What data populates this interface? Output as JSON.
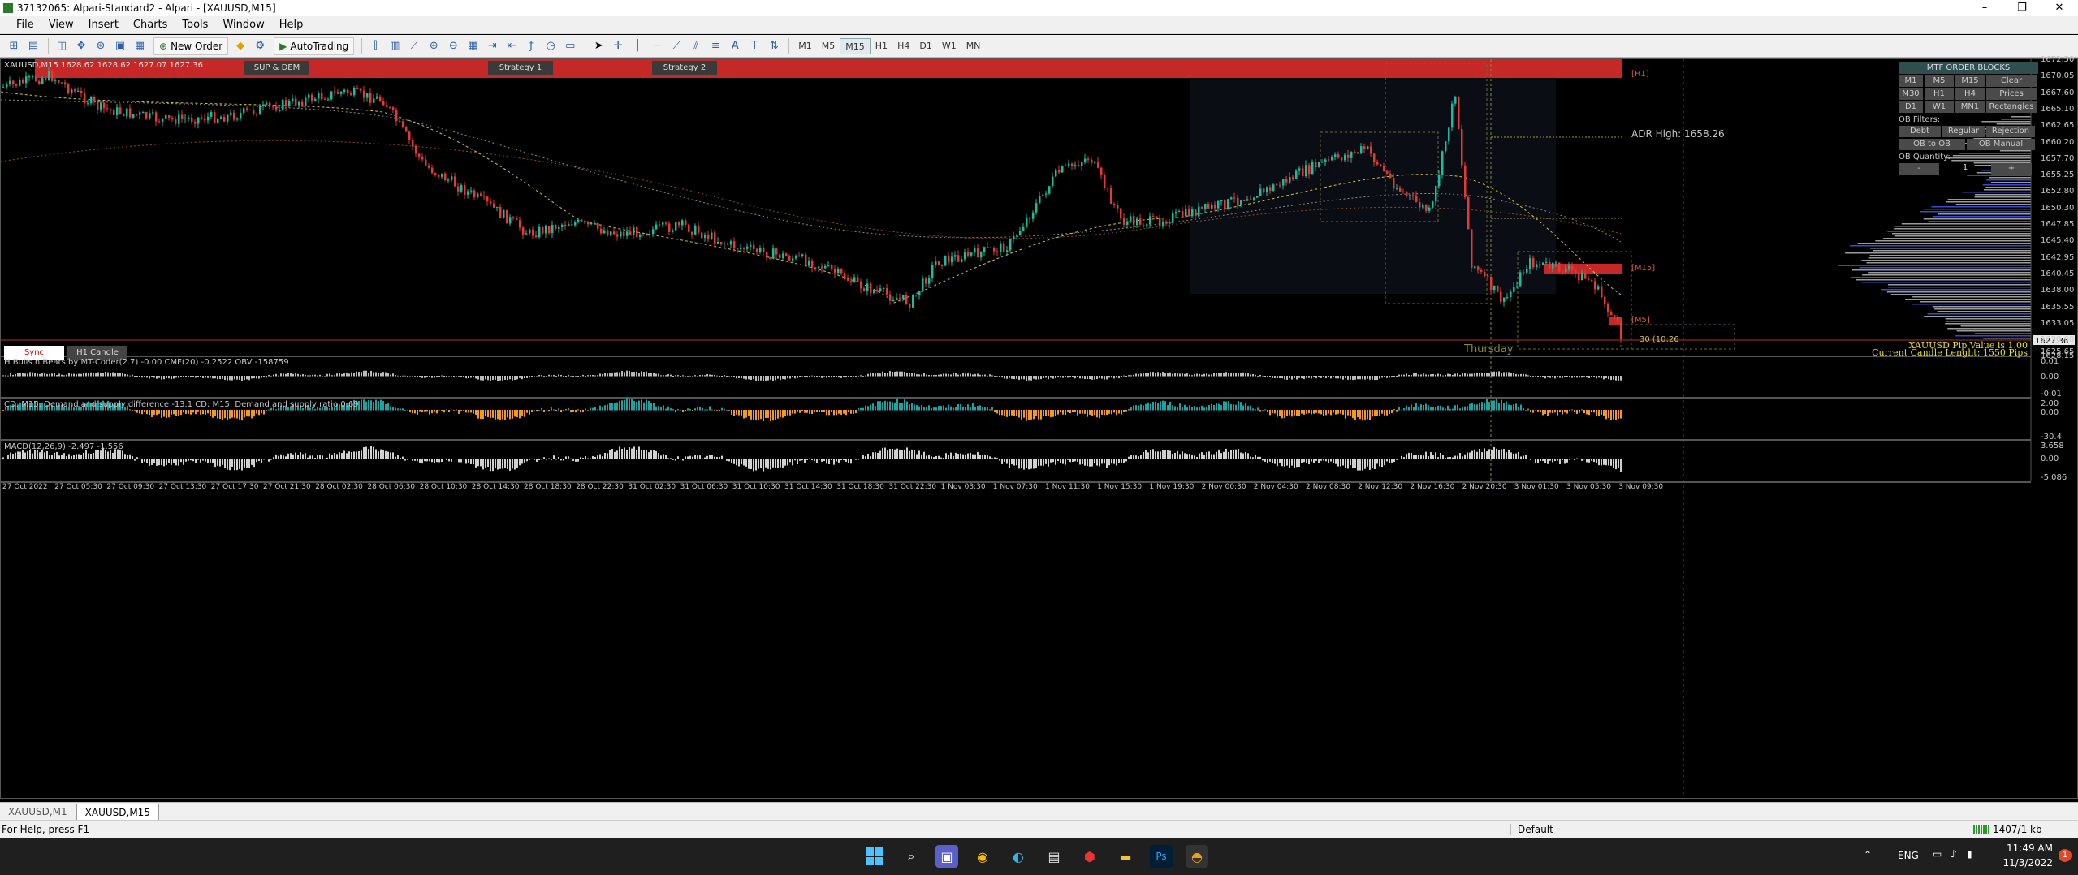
{
  "window": {
    "title": "37132065: Alpari-Standard2 - Alpari - [XAUUSD,M15]",
    "minimize": "–",
    "maximize": "❐",
    "close": "✕"
  },
  "menu": [
    "File",
    "View",
    "Insert",
    "Charts",
    "Tools",
    "Window",
    "Help"
  ],
  "toolbar": {
    "new_order": "New Order",
    "autotrading": "AutoTrading",
    "timeframes": [
      "M1",
      "M5",
      "M15",
      "H1",
      "H4",
      "D1",
      "W1",
      "MN"
    ],
    "active_timeframe": "M15"
  },
  "chart": {
    "info": "XAUUSD,M15 1628.62 1628.62 1627.07 1627.36",
    "buttons": [
      "SUP & DEM",
      "Strategy 1",
      "Strategy 2"
    ],
    "sync_button": "Sync",
    "h1_candle_button": "H1 Candle",
    "zone_labels": {
      "h1": "[H1]",
      "m15": "[M15]",
      "m5": "[M5]"
    },
    "adr_high": "ADR High: 1658.26",
    "timer": "30 (10:26",
    "day_label": "Thursday",
    "pip_value": "XAUUSD Pip Value is 1.00",
    "candle_length": "Current Candle Lenght: 1550 Pips",
    "price_axis": [
      "1672.50",
      "1670.05",
      "1667.60",
      "1665.10",
      "1662.65",
      "1660.20",
      "1657.70",
      "1655.25",
      "1652.80",
      "1650.30",
      "1647.85",
      "1645.40",
      "1642.95",
      "1640.45",
      "1638.00",
      "1635.55",
      "1633.05",
      "1630.60",
      "1628.15",
      "1627.36",
      "1625.65"
    ],
    "current_price": "1627.36",
    "time_axis": [
      "27 Oct 2022",
      "27 Oct 05:30",
      "27 Oct 09:30",
      "27 Oct 13:30",
      "27 Oct 17:30",
      "27 Oct 21:30",
      "28 Oct 02:30",
      "28 Oct 06:30",
      "28 Oct 10:30",
      "28 Oct 14:30",
      "28 Oct 18:30",
      "28 Oct 22:30",
      "31 Oct 02:30",
      "31 Oct 06:30",
      "31 Oct 10:30",
      "31 Oct 14:30",
      "31 Oct 18:30",
      "31 Oct 22:30",
      "1 Nov 03:30",
      "1 Nov 07:30",
      "1 Nov 11:30",
      "1 Nov 15:30",
      "1 Nov 19:30",
      "2 Nov 00:30",
      "2 Nov 04:30",
      "2 Nov 08:30",
      "2 Nov 12:30",
      "2 Nov 16:30",
      "2 Nov 20:30",
      "3 Nov 01:30",
      "3 Nov 05:30",
      "3 Nov 09:30"
    ]
  },
  "panel": {
    "header": "MTF ORDER BLOCKS",
    "tf_rows": [
      [
        "M1",
        "M5",
        "M15",
        "Clear"
      ],
      [
        "M30",
        "H1",
        "H4",
        "Prices"
      ],
      [
        "D1",
        "W1",
        "MN1",
        "Rectangles"
      ]
    ],
    "filters_label": "OB Filters:",
    "filter_rows": [
      [
        "Debt",
        "Regular",
        "Rejection"
      ],
      [
        "OB to OB",
        "OB Manual"
      ]
    ],
    "quantity_label": "OB Quantity:",
    "quantity_minus": "-",
    "quantity_value": "1",
    "quantity_plus": "+"
  },
  "indicators": [
    {
      "title": "H Bulls n Bears by MT-Coder(2.7) -0.00  CMF(20) -0.2522  OBV  -158759",
      "scale": [
        "0.01",
        "0.00",
        "-0.01"
      ]
    },
    {
      "title": "CD: M15: Demand and supply difference  -13.1  CD: M15: Demand and supply ratio  0.69",
      "scale": [
        "2.00",
        "0.00",
        "-30.4"
      ]
    },
    {
      "title": "MACD(12,26,9) -2.497 -1.556",
      "scale": [
        "3.658",
        "0.00",
        "-5.086"
      ]
    }
  ],
  "tabs": [
    "XAUUSD,M1",
    "XAUUSD,M15"
  ],
  "active_tab": "XAUUSD,M15",
  "status": {
    "help": "For Help, press F1",
    "profile": "Default",
    "traffic": "1407/1 kb"
  },
  "taskbar": {
    "lang": "ENG",
    "time": "11:49 AM",
    "date": "11/3/2022",
    "notif": "1"
  }
}
